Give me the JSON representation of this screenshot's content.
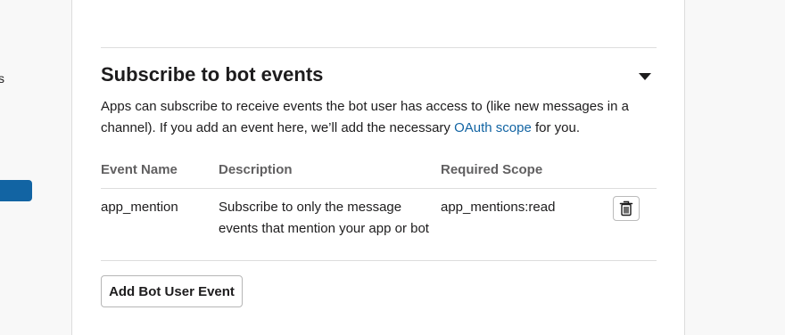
{
  "sidebar": {
    "fragment_text": "s"
  },
  "section": {
    "title": "Subscribe to bot events",
    "description_before": "Apps can subscribe to receive events the bot user has access to (like new messages in a channel). If you add an event here, we’ll add the necessary ",
    "description_link": "OAuth scope",
    "description_after": " for you."
  },
  "table": {
    "headers": {
      "event_name": "Event Name",
      "description": "Description",
      "required_scope": "Required Scope"
    },
    "rows": [
      {
        "event_name": "app_mention",
        "description": "Subscribe to only the message events that mention your app or bot",
        "required_scope": "app_mentions:read"
      }
    ]
  },
  "actions": {
    "add_label": "Add Bot User Event"
  },
  "icons": {
    "delete": "trash-icon",
    "toggle": "caret-down-icon"
  },
  "colors": {
    "link": "#1264a3",
    "sidebar_active": "#1264a3"
  }
}
